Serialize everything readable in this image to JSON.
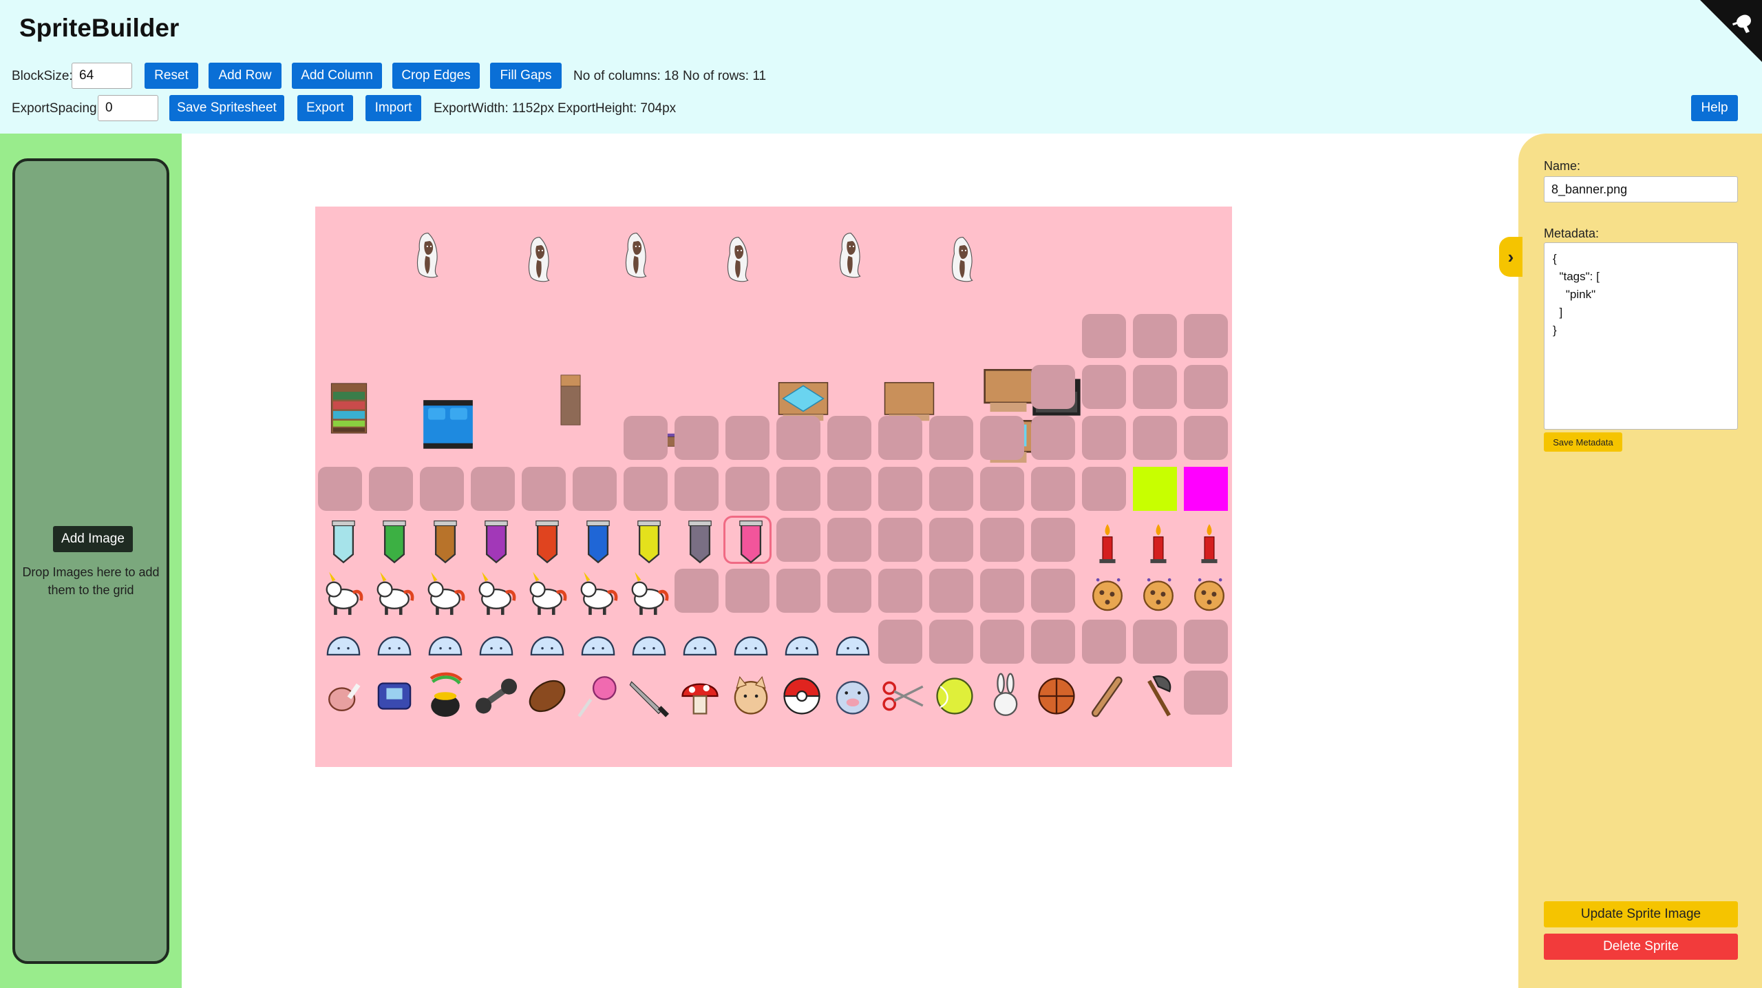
{
  "app": {
    "title": "SpriteBuilder"
  },
  "toolbar": {
    "block_size_label": "BlockSize:",
    "block_size_value": "64",
    "reset_label": "Reset",
    "add_row_label": "Add Row",
    "add_column_label": "Add Column",
    "crop_edges_label": "Crop Edges",
    "fill_gaps_label": "Fill Gaps",
    "columns_info": "No of columns: 18",
    "rows_info": "No of rows: 11",
    "export_spacing_label": "ExportSpacing:",
    "export_spacing_value": "0",
    "save_spritesheet_label": "Save Spritesheet",
    "export_label": "Export",
    "import_label": "Import",
    "export_width": "ExportWidth: 1152px",
    "export_height": "ExportHeight: 704px",
    "help_label": "Help"
  },
  "drop_panel": {
    "add_image_label": "Add Image",
    "hint": "Drop Images here to add them to the grid"
  },
  "grid": {
    "columns": 18,
    "rows": 11,
    "background": "#ffc0cb",
    "empty_cell_color": "#d09aa4",
    "ghosts": [
      "ghost-sprite",
      "ghost-sprite",
      "ghost-sprite",
      "ghost-sprite",
      "ghost-sprite",
      "ghost-sprite"
    ],
    "furniture": [
      "bookshelf-sprite",
      "bed-blue-sprite",
      "wardrobe-sprite",
      "bed-purple-sprite",
      "table-blue-sprite",
      "table-plain-sprite",
      "nightstand-sprite",
      "lost-sign-sprite",
      "monitor-sprite"
    ],
    "color_blocks": [
      "#c8ff00",
      "#ff00ff"
    ],
    "banners": [
      "#a6e3ea",
      "#3cb043",
      "#b8732a",
      "#a238b8",
      "#e0441f",
      "#1f66d6",
      "#e4e11c",
      "#7a6f84",
      "#f2559b"
    ],
    "candles": [
      "candle-sprite",
      "candle-sprite",
      "candle-sprite"
    ],
    "unicorns": [
      "unicorn-sprite",
      "unicorn-sprite",
      "unicorn-sprite",
      "unicorn-sprite",
      "unicorn-sprite",
      "unicorn-sprite",
      "unicorn-sprite"
    ],
    "cookies": [
      "cookie-sprite",
      "cookie-sprite",
      "cookie-sprite"
    ],
    "slimes": [
      "slime-sprite",
      "slime-sprite",
      "slime-sprite",
      "slime-sprite",
      "slime-sprite",
      "slime-sprite",
      "slime-sprite",
      "slime-sprite",
      "slime-sprite",
      "slime-sprite",
      "slime-sprite"
    ],
    "items": [
      "ham-icon",
      "gameboy-icon",
      "pot-of-gold-icon",
      "dumbbell-icon",
      "football-icon",
      "lollipop-icon",
      "knife-icon",
      "mushroom-icon",
      "cat-icon",
      "pokeball-icon",
      "pig-icon",
      "scissors-icon",
      "tennis-ball-icon",
      "bunny-icon",
      "basketball-icon",
      "bat-icon",
      "axe-icon"
    ]
  },
  "sprite_panel": {
    "name_label": "Name:",
    "name_value": "8_banner.png",
    "metadata_label": "Metadata:",
    "metadata_value": "{\n  \"tags\": [\n    \"pink\"\n  ]\n}",
    "save_metadata_label": "Save Metadata",
    "update_sprite_label": "Update Sprite Image",
    "delete_sprite_label": "Delete Sprite",
    "toggle_icon": "chevron-right-icon"
  },
  "colors": {
    "header_bg": "#e0fcfc",
    "accent_button": "#0a6fd6",
    "left_panel_bg": "#99ec8c",
    "right_panel_bg": "#f7e08a",
    "save_button": "#f5c400",
    "delete_button": "#f23b3b"
  }
}
